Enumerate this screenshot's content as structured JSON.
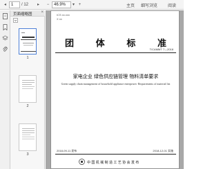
{
  "toolbar": {
    "page_current": "1",
    "page_total": "/ 12",
    "zoom": "46.9%",
    "link_home": "主页",
    "link_browse": "细写浏览",
    "link_read": "阅读"
  },
  "panel": {
    "title": "页面缩略图",
    "close": "×",
    "thumbnails": [
      {
        "number": "1"
      },
      {
        "number": "2"
      },
      {
        "number": "3"
      }
    ]
  },
  "document": {
    "ics": "ICS xx.xxx",
    "ccs": "X xx",
    "title_chars": [
      "团",
      "体",
      "标",
      "准"
    ],
    "code": "T/CAMMT 7—2018",
    "title_cn": "家电企业  绿色供应链管理  物料清单要求",
    "title_en": "Green supply chain management of household appliance enterprises- Requirements of material list",
    "issue_date": "2018-09-11 发布",
    "impl_date": "2018-12-01 实施",
    "publisher": "中 国 机 械 制 造 工 艺 协 会  发 布"
  }
}
